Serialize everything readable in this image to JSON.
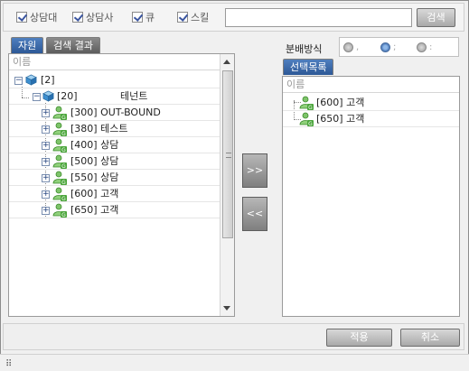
{
  "filters": {
    "items": [
      {
        "label": "상담대",
        "checked": true
      },
      {
        "label": "상담사",
        "checked": true
      },
      {
        "label": "큐",
        "checked": true
      },
      {
        "label": "스킬",
        "checked": true
      }
    ],
    "search_value": "",
    "search_button": "검색"
  },
  "left": {
    "tabs": [
      {
        "label": "자원",
        "active": true
      },
      {
        "label": "검색 결과",
        "active": false
      }
    ],
    "column_header": "이름",
    "tree": [
      {
        "label": "[2]",
        "level": 0,
        "type": "group"
      },
      {
        "label": "[20]",
        "suffix": "테넌트",
        "level": 1,
        "type": "group"
      },
      {
        "label": "[300] OUT-BOUND",
        "level": 2,
        "type": "skill"
      },
      {
        "label": "[380] 테스트",
        "level": 2,
        "type": "skill"
      },
      {
        "label": "[400] 상담",
        "level": 2,
        "type": "skill"
      },
      {
        "label": "[500] 상담",
        "level": 2,
        "type": "skill"
      },
      {
        "label": "[550] 상담",
        "level": 2,
        "type": "skill"
      },
      {
        "label": "[600] 고객",
        "level": 2,
        "type": "skill"
      },
      {
        "label": "[650] 고객",
        "level": 2,
        "type": "skill"
      }
    ]
  },
  "move_buttons": {
    "add": ">>",
    "remove": "<<"
  },
  "distribution": {
    "label": "분배방식",
    "options": [
      {
        "text": ",",
        "selected": false
      },
      {
        "text": ";",
        "selected": true
      },
      {
        "text": ":",
        "selected": false
      }
    ]
  },
  "right": {
    "tab": "선택목록",
    "column_header": "이름",
    "items": [
      {
        "label": "[600] 고객"
      },
      {
        "label": "[650] 고객"
      }
    ]
  },
  "actions": {
    "apply": "적용",
    "cancel": "취소"
  },
  "status": {
    "grip": "⠿"
  },
  "colors": {
    "accent": "#3d6aa8",
    "button_gray": "#a9a9a9"
  }
}
